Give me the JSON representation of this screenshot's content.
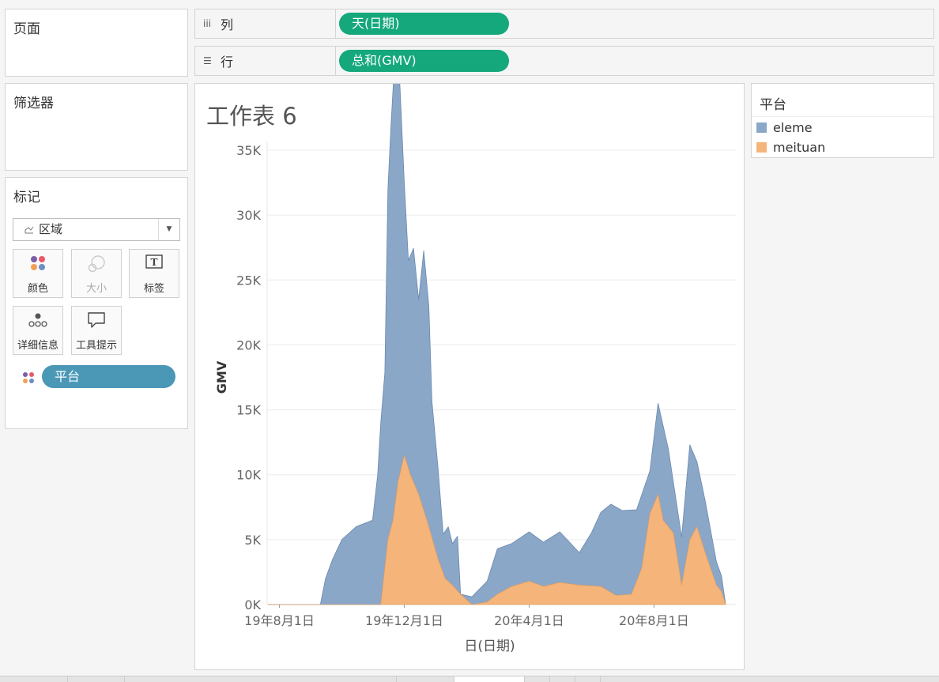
{
  "panels": {
    "pages_title": "页面",
    "filters_title": "筛选器",
    "marks_title": "标记"
  },
  "shelves": {
    "columns": {
      "icon": "columns-icon",
      "label": "列",
      "pill": "天(日期)"
    },
    "rows": {
      "icon": "rows-icon",
      "label": "行",
      "pill": "总和(GMV)"
    }
  },
  "marks": {
    "mark_type": "区域",
    "buttons": [
      {
        "icon": "color-icon",
        "label": "颜色",
        "enabled": true
      },
      {
        "icon": "size-icon",
        "label": "大小",
        "enabled": false
      },
      {
        "icon": "label-icon",
        "label": "标签",
        "enabled": true
      },
      {
        "icon": "detail-icon",
        "label": "详细信息",
        "enabled": true
      },
      {
        "icon": "tooltip-icon",
        "label": "工具提示",
        "enabled": true
      }
    ],
    "field_pill": "平台"
  },
  "legend": {
    "title": "平台",
    "items": [
      {
        "label": "eleme",
        "color": "#8ba7c8"
      },
      {
        "label": "meituan",
        "color": "#f4b47a"
      }
    ]
  },
  "worksheet": {
    "title": "工作表 6"
  },
  "chart_data": {
    "type": "area",
    "stacked": true,
    "ylabel": "GMV",
    "xlabel": "日(日期)",
    "y_ticks": [
      "0K",
      "5K",
      "10K",
      "15K",
      "20K",
      "25K",
      "30K",
      "35K"
    ],
    "ylim": [
      0,
      35000
    ],
    "x_ticks": [
      "19年8月1日",
      "19年12月1日",
      "20年4月1日",
      "20年8月1日"
    ],
    "x_tick_dates": [
      "2019-08-01",
      "2019-12-01",
      "2020-04-01",
      "2020-08-01"
    ],
    "xlim": [
      "2019-07-20",
      "2020-10-20"
    ],
    "grid": true,
    "series": [
      {
        "name": "meituan",
        "color": "#f4b47a",
        "x": [
          "2019-07-21",
          "2019-08-15",
          "2019-09-10",
          "2019-09-26",
          "2019-10-15",
          "2019-10-31",
          "2019-11-08",
          "2019-11-15",
          "2019-11-20",
          "2019-11-25",
          "2019-12-01",
          "2019-12-07",
          "2019-12-15",
          "2019-12-25",
          "2020-01-03",
          "2020-01-10",
          "2020-01-17",
          "2020-01-25",
          "2020-02-05",
          "2020-02-20",
          "2020-03-01",
          "2020-03-15",
          "2020-04-01",
          "2020-04-15",
          "2020-05-01",
          "2020-05-20",
          "2020-06-10",
          "2020-06-25",
          "2020-07-10",
          "2020-07-20",
          "2020-07-28",
          "2020-08-05",
          "2020-08-10",
          "2020-08-20",
          "2020-08-28",
          "2020-09-05",
          "2020-09-12",
          "2020-09-20",
          "2020-10-01",
          "2020-10-06",
          "2020-10-10"
        ],
        "y": [
          0,
          0,
          0,
          0,
          0,
          0,
          0,
          5000,
          6500,
          9500,
          11500,
          10000,
          8500,
          6000,
          3500,
          2000,
          1500,
          800,
          0,
          200,
          800,
          1400,
          1800,
          1400,
          1700,
          1500,
          1400,
          700,
          800,
          2800,
          7000,
          8500,
          6500,
          5500,
          1500,
          5000,
          6000,
          4000,
          1500,
          1000,
          0
        ]
      },
      {
        "name": "eleme",
        "color": "#8ba7c8",
        "x": [
          "2019-07-21",
          "2019-08-15",
          "2019-09-10",
          "2019-09-15",
          "2019-09-22",
          "2019-10-01",
          "2019-10-15",
          "2019-10-31",
          "2019-11-05",
          "2019-11-08",
          "2019-11-12",
          "2019-11-15",
          "2019-11-18",
          "2019-11-21",
          "2019-11-25",
          "2019-12-01",
          "2019-12-05",
          "2019-12-10",
          "2019-12-15",
          "2019-12-20",
          "2019-12-25",
          "2019-12-28",
          "2020-01-03",
          "2020-01-08",
          "2020-01-13",
          "2020-01-17",
          "2020-01-22",
          "2020-01-25",
          "2020-02-05",
          "2020-02-20",
          "2020-03-01",
          "2020-03-15",
          "2020-04-01",
          "2020-04-15",
          "2020-05-01",
          "2020-05-20",
          "2020-06-01",
          "2020-06-10",
          "2020-06-20",
          "2020-07-01",
          "2020-07-15",
          "2020-07-28",
          "2020-08-05",
          "2020-08-15",
          "2020-08-28",
          "2020-09-05",
          "2020-09-12",
          "2020-09-20",
          "2020-10-01",
          "2020-10-06",
          "2020-10-10"
        ],
        "y": [
          0,
          0,
          0,
          2000,
          3500,
          5000,
          6000,
          6500,
          10000,
          14000,
          15000,
          27000,
          31000,
          34000,
          33500,
          21000,
          16000,
          18000,
          15000,
          20000,
          17000,
          10500,
          7000,
          3000,
          4200,
          3200,
          4200,
          0,
          600,
          1600,
          3500,
          3300,
          3800,
          3400,
          3900,
          2500,
          4100,
          5700,
          6800,
          6500,
          5500,
          3300,
          7000,
          6000,
          3700,
          7300,
          5000,
          4000,
          1800,
          1200,
          0
        ]
      }
    ]
  }
}
